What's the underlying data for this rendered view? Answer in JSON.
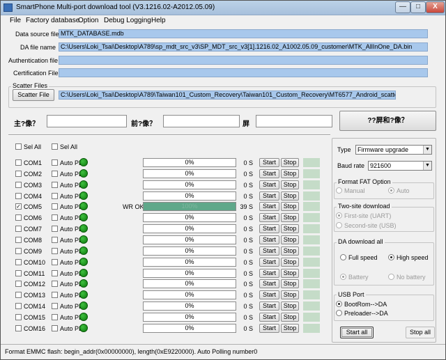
{
  "window": {
    "title": "SmartPhone Multi-port download tool (V3.1216.02-A2012.05.09)",
    "minimize": "—",
    "maximize": "□",
    "close": "X"
  },
  "menu": [
    "File",
    "Factory database",
    "Option",
    "Debug Logging",
    "Help"
  ],
  "files": {
    "data_source_label": "Data source file",
    "data_source_value": "MTK_DATABASE.mdb",
    "da_label": "DA file name",
    "da_value": "C:\\Users\\Loki_Tsai\\Desktop\\A789\\sp_mdt_src_v3\\SP_MDT_src_v3[1].1216.02_A1002.05.09_customer\\MTK_AllInOne_DA.bin",
    "auth_label": "Authentication file",
    "auth_value": "",
    "cert_label": "Certification File",
    "cert_value": ""
  },
  "scatter": {
    "group_title": "Scatter Files",
    "button": "Scatter File",
    "path": "C:\\Users\\Loki_Tsai\\Desktop\\A789\\Taiwan101_Custom_Recovery\\Taiwan101_Custom_Recovery\\MT6577_Android_scatter_emmc.txt"
  },
  "image_row": {
    "label1": "主?像？",
    "label2": "前?像？",
    "label3": "屏",
    "button": "??屏和?像？"
  },
  "sel_all_1": "Sel All",
  "sel_all_2": "Sel All",
  "ports": [
    {
      "com": "COM1",
      "checked": false,
      "auto": "Auto PL",
      "status": "",
      "pct": "0%",
      "progress": 0,
      "time": "0 S"
    },
    {
      "com": "COM2",
      "checked": false,
      "auto": "Auto PL",
      "status": "",
      "pct": "0%",
      "progress": 0,
      "time": "0 S"
    },
    {
      "com": "COM3",
      "checked": false,
      "auto": "Auto PL",
      "status": "",
      "pct": "0%",
      "progress": 0,
      "time": "0 S"
    },
    {
      "com": "COM4",
      "checked": false,
      "auto": "Auto PL",
      "status": "",
      "pct": "0%",
      "progress": 0,
      "time": "0 S"
    },
    {
      "com": "COM5",
      "checked": true,
      "auto": "Auto PL",
      "status": "WR OK",
      "pct": "100%",
      "progress": 1,
      "time": "39 S"
    },
    {
      "com": "COM6",
      "checked": false,
      "auto": "Auto PL",
      "status": "",
      "pct": "0%",
      "progress": 0,
      "time": "0 S"
    },
    {
      "com": "COM7",
      "checked": false,
      "auto": "Auto PL",
      "status": "",
      "pct": "0%",
      "progress": 0,
      "time": "0 S"
    },
    {
      "com": "COM8",
      "checked": false,
      "auto": "Auto PL",
      "status": "",
      "pct": "0%",
      "progress": 0,
      "time": "0 S"
    },
    {
      "com": "COM9",
      "checked": false,
      "auto": "Auto PL",
      "status": "",
      "pct": "0%",
      "progress": 0,
      "time": "0 S"
    },
    {
      "com": "COM10",
      "checked": false,
      "auto": "Auto PL",
      "status": "",
      "pct": "0%",
      "progress": 0,
      "time": "0 S"
    },
    {
      "com": "COM11",
      "checked": false,
      "auto": "Auto PL",
      "status": "",
      "pct": "0%",
      "progress": 0,
      "time": "0 S"
    },
    {
      "com": "COM12",
      "checked": false,
      "auto": "Auto PL",
      "status": "",
      "pct": "0%",
      "progress": 0,
      "time": "0 S"
    },
    {
      "com": "COM13",
      "checked": false,
      "auto": "Auto PL",
      "status": "",
      "pct": "0%",
      "progress": 0,
      "time": "0 S"
    },
    {
      "com": "COM14",
      "checked": false,
      "auto": "Auto PL",
      "status": "",
      "pct": "0%",
      "progress": 0,
      "time": "0 S"
    },
    {
      "com": "COM15",
      "checked": false,
      "auto": "Auto PL",
      "status": "",
      "pct": "0%",
      "progress": 0,
      "time": "0 S"
    },
    {
      "com": "COM16",
      "checked": false,
      "auto": "Auto PL",
      "status": "",
      "pct": "0%",
      "progress": 0,
      "time": "0 S"
    }
  ],
  "row_buttons": {
    "start": "Start",
    "stop": "Stop"
  },
  "settings": {
    "type_label": "Type",
    "type_value": "Firmware upgrade",
    "baud_label": "Baud rate",
    "baud_value": "921600",
    "fat_title": "Format FAT Option",
    "fat_manual": "Manual",
    "fat_auto": "Auto",
    "two_site_title": "Two-site download",
    "two_site_first": "First-site (UART)",
    "two_site_second": "Second-site (USB)",
    "da_all_title": "DA download all",
    "full_speed": "Full speed",
    "high_speed": "High speed",
    "battery": "Battery",
    "no_battery": "No battery",
    "usb_title": "USB Port",
    "usb_bootrom": "BootRom-->DA",
    "usb_preloader": "Preloader-->DA",
    "start_all": "Start all",
    "stop_all": "Stop all"
  },
  "status_bar": "Format EMMC flash:  begin_addr(0x00000000), length(0xE9220000). Auto Polling number0",
  "colors": {
    "field_bg": "#a8c8ec",
    "led_green": "#1a9a1a",
    "progress_fill": "#5fa88a"
  }
}
